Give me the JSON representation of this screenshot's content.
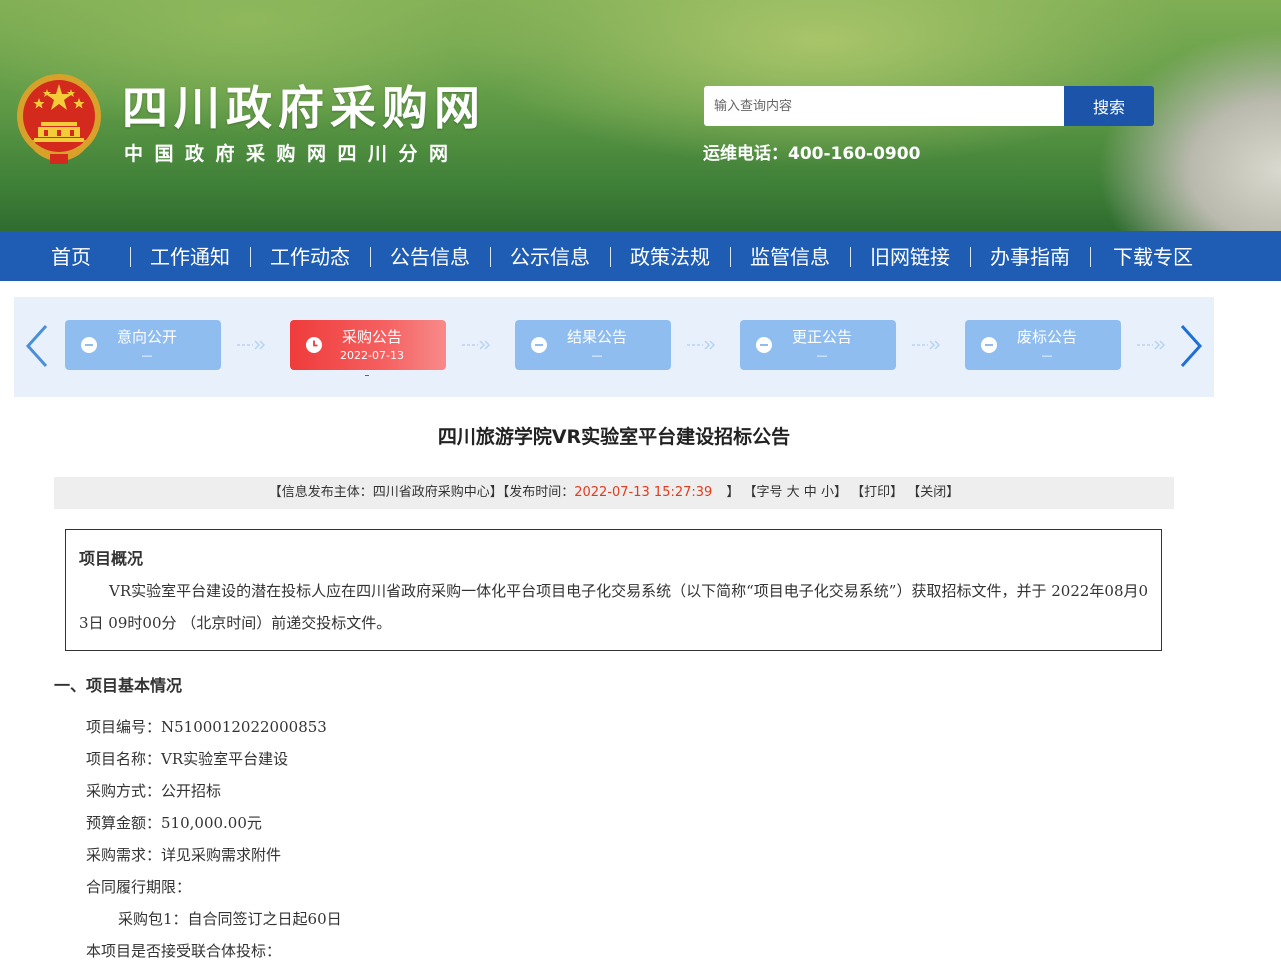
{
  "header": {
    "site_title": "四川政府采购网",
    "site_subtitle": "中国政府采购网四川分网",
    "search_placeholder": "输入查询内容",
    "search_button": "搜索",
    "hotline": "运维电话：400-160-0900"
  },
  "nav": {
    "items": [
      "首页",
      "工作通知",
      "工作动态",
      "公告信息",
      "公示信息",
      "政策法规",
      "监管信息",
      "旧网链接",
      "办事指南",
      "下载专区"
    ]
  },
  "process": {
    "steps": [
      {
        "label": "意向公开",
        "date": "—",
        "active": false
      },
      {
        "label": "采购公告",
        "date": "2022-07-13",
        "active": true
      },
      {
        "label": "结果公告",
        "date": "—",
        "active": false
      },
      {
        "label": "更正公告",
        "date": "—",
        "active": false
      },
      {
        "label": "废标公告",
        "date": "—",
        "active": false
      }
    ],
    "prev_icon": "chevron-left-icon",
    "next_icon": "chevron-right-icon"
  },
  "article": {
    "title": "四川旅游学院VR实验室平台建设招标公告",
    "meta": {
      "publisher_prefix": "【信息发布主体：四川省政府采购中心】【发布时间：",
      "publish_time": "2022-07-13 15:27:39",
      "publisher_suffix": "】",
      "font_size_label": "【字号",
      "font_large": "大",
      "font_medium": "中",
      "font_small": "小",
      "font_close": "】",
      "print": "【打印】",
      "close": "【关闭】"
    },
    "overview": {
      "title": "项目概况",
      "text": "VR实验室平台建设的潜在投标人应在四川省政府采购一体化平台项目电子化交易系统（以下简称“项目电子化交易系统”）获取招标文件，并于 2022年08月03日 09时00分 （北京时间）前递交投标文件。"
    },
    "section1": {
      "title": "一、项目基本情况",
      "lines": [
        "项目编号：N5100012022000853",
        "项目名称：VR实验室平台建设",
        "采购方式：公开招标",
        "预算金额：510,000.00元",
        "采购需求：详见采购需求附件",
        "合同履行期限："
      ],
      "package_line": "采购包1：自合同签订之日起60日",
      "consortium_line": "本项目是否接受联合体投标："
    }
  },
  "colors": {
    "nav_bg": "#1e5db3",
    "search_btn": "#1b54a8",
    "active_step": "#ef3b3b",
    "inactive_step": "#8fbdf0",
    "highlight_red": "#e23b1c"
  }
}
